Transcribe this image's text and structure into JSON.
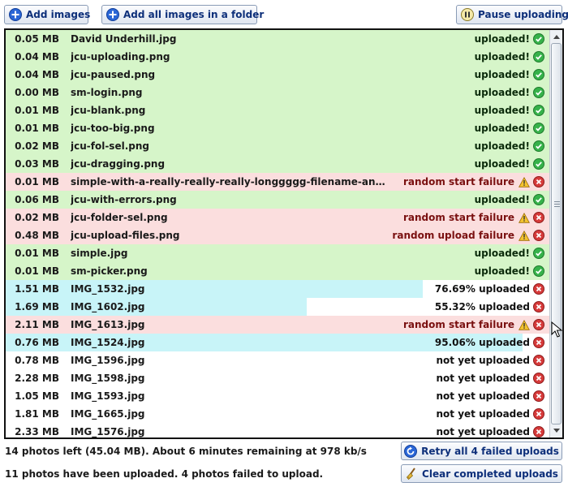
{
  "toolbar": {
    "add_images_label": "Add images",
    "add_folder_label": "Add all images in a folder",
    "pause_label": "Pause uploading"
  },
  "colors": {
    "uploaded_bg": "#d6f5c9",
    "failed_bg": "#fbdede",
    "progress_bg": "#c8f4f8"
  },
  "files": [
    {
      "size": "0.05 MB",
      "name": "David Underhill.jpg",
      "status": "uploaded!",
      "state": "uploaded"
    },
    {
      "size": "0.04 MB",
      "name": "jcu-uploading.png",
      "status": "uploaded!",
      "state": "uploaded"
    },
    {
      "size": "0.04 MB",
      "name": "jcu-paused.png",
      "status": "uploaded!",
      "state": "uploaded"
    },
    {
      "size": "0.00 MB",
      "name": "sm-login.png",
      "status": "uploaded!",
      "state": "uploaded"
    },
    {
      "size": "0.01 MB",
      "name": "jcu-blank.png",
      "status": "uploaded!",
      "state": "uploaded"
    },
    {
      "size": "0.01 MB",
      "name": "jcu-too-big.png",
      "status": "uploaded!",
      "state": "uploaded"
    },
    {
      "size": "0.02 MB",
      "name": "jcu-fol-sel.png",
      "status": "uploaded!",
      "state": "uploaded"
    },
    {
      "size": "0.03 MB",
      "name": "jcu-dragging.png",
      "status": "uploaded!",
      "state": "uploaded"
    },
    {
      "size": "0.01 MB",
      "name": "simple-with-a-really-really-really-longgggg-filename-and...",
      "status": "random start failure",
      "state": "failed"
    },
    {
      "size": "0.06 MB",
      "name": "jcu-with-errors.png",
      "status": "uploaded!",
      "state": "uploaded"
    },
    {
      "size": "0.02 MB",
      "name": "jcu-folder-sel.png",
      "status": "random start failure",
      "state": "failed"
    },
    {
      "size": "0.48 MB",
      "name": "jcu-upload-files.png",
      "status": "random upload failure",
      "state": "failed"
    },
    {
      "size": "0.01 MB",
      "name": "simple.jpg",
      "status": "uploaded!",
      "state": "uploaded"
    },
    {
      "size": "0.01 MB",
      "name": "sm-picker.png",
      "status": "uploaded!",
      "state": "uploaded"
    },
    {
      "size": "1.51 MB",
      "name": "IMG_1532.jpg",
      "status": "76.69% uploaded",
      "state": "progress",
      "progress": 0.7669
    },
    {
      "size": "1.69 MB",
      "name": "IMG_1602.jpg",
      "status": "55.32% uploaded",
      "state": "progress",
      "progress": 0.5532
    },
    {
      "size": "2.11 MB",
      "name": "IMG_1613.jpg",
      "status": "random start failure",
      "state": "failed"
    },
    {
      "size": "0.76 MB",
      "name": "IMG_1524.jpg",
      "status": "95.06% uploaded",
      "state": "progress",
      "progress": 0.9506
    },
    {
      "size": "0.78 MB",
      "name": "IMG_1596.jpg",
      "status": "not yet uploaded",
      "state": "pending"
    },
    {
      "size": "2.28 MB",
      "name": "IMG_1598.jpg",
      "status": "not yet uploaded",
      "state": "pending"
    },
    {
      "size": "1.05 MB",
      "name": "IMG_1593.jpg",
      "status": "not yet uploaded",
      "state": "pending"
    },
    {
      "size": "1.81 MB",
      "name": "IMG_1665.jpg",
      "status": "not yet uploaded",
      "state": "pending"
    },
    {
      "size": "2.33 MB",
      "name": "IMG_1576.jpg",
      "status": "not yet uploaded",
      "state": "pending"
    }
  ],
  "footer": {
    "remaining_text": "14 photos left (45.04 MB).  About 6 minutes remaining at 978 kb/s",
    "summary_text": "11 photos have been uploaded.  4 photos failed to upload.",
    "retry_label": "Retry all 4 failed uploads",
    "clear_label": "Clear completed uploads"
  }
}
